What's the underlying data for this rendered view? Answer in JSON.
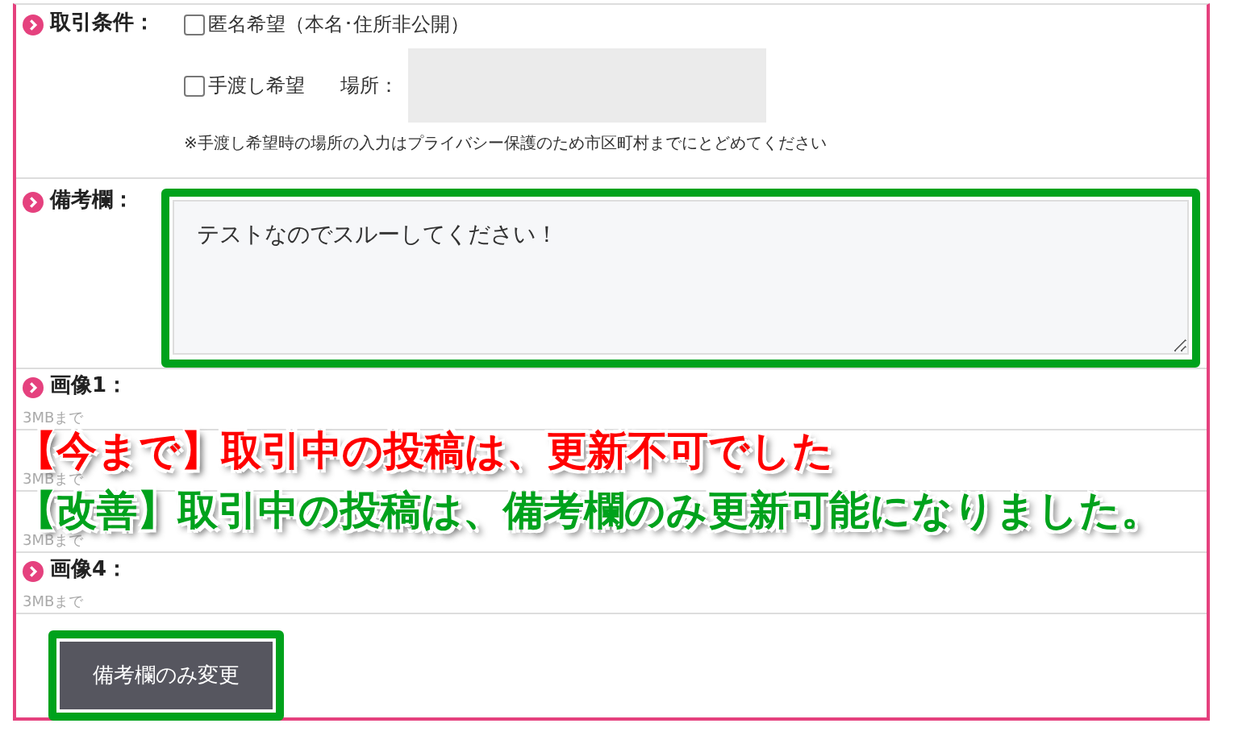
{
  "conditions": {
    "label": "取引条件：",
    "options": [
      {
        "label": "匿名希望（本名･住所非公開）",
        "checked": false
      },
      {
        "label": "手渡し希望",
        "checked": false
      }
    ],
    "place_label": "場所：",
    "note": "※手渡し希望時の場所の入力はプライバシー保護のため市区町村までにとどめてください"
  },
  "remarks": {
    "label": "備考欄：",
    "value": "テストなのでスルーしてください！"
  },
  "images": [
    {
      "label": "画像1：",
      "hint": "3MBまで"
    },
    {
      "hint": "3MBまで"
    },
    {
      "hint": "3MBまで"
    },
    {
      "label": "画像4：",
      "hint": "3MBまで"
    }
  ],
  "annotations": [
    {
      "text": "【今まで】取引中の投稿は、更新不可でした",
      "color": "#ff0000"
    },
    {
      "text": "【改善】取引中の投稿は、備考欄のみ更新可能になりました。",
      "color": "#00a21c"
    }
  ],
  "submit_button": "備考欄のみ変更"
}
